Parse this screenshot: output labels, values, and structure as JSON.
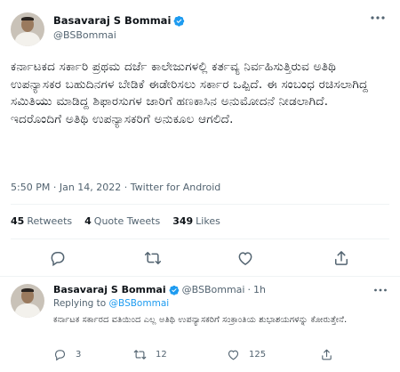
{
  "tweet": {
    "author_name": "Basavaraj S Bommai",
    "handle": "@BSBommai",
    "text": "ಕರ್ನಾಟಕದ ಸರ್ಕಾರಿ ಪ್ರಥಮ ದರ್ಜೆ ಕಾಲೇಜುಗಳಲ್ಲಿ ಕರ್ತವ್ಯ ನಿರ್ವಹಿಸುತ್ತಿರುವ ಅತಿಥಿ ಉಪನ್ಯಾಸಕರ ಬಹುದಿನಗಳ ಬೇಡಿಕೆ ಈಡೇರಿಸಲು ಸರ್ಕಾರ ಒಪ್ಪಿದೆ. ಈ ಸಂಬಂಧ ರಚಿಸಲಾಗಿದ್ದ ಸಮಿತಿಯು ಮಾಡಿದ್ದ ಶಿಫಾರಸುಗಳ ಜಾರಿಗೆ ಹಣಕಾಸಿನ ಅನುಮೋದನೆ ನೀಡಲಾಗಿದೆ. ಇದರೊಂದಿಗೆ  ಅತಿಥಿ ಉಪನ್ಯಾಸಕರಿಗೆ ಅನುಕೂಲ ಆಗಲಿದೆ.",
    "time": "5:50 PM",
    "date": "Jan 14, 2022",
    "source": "Twitter for Android",
    "separator": "·",
    "retweets_count": "45",
    "retweets_label": "Retweets",
    "quotes_count": "4",
    "quotes_label": "Quote Tweets",
    "likes_count": "349",
    "likes_label": "Likes"
  },
  "reply": {
    "author_name": "Basavaraj S Bommai",
    "handle": "@BSBommai",
    "age": "1h",
    "separator": "·",
    "replying_prefix": "Replying to",
    "replying_to": "@BSBommai",
    "text": "ಕರ್ನಾಟಕ ಸರ್ಕಾರದ ವತಿಯಿಂದ ಎಲ್ಲ ಅತಿಥಿ ಉಪನ್ಯಾಸಕರಿಗೆ ಸಂಕ್ರಾಂತಿಯ ಶುಭಾಶಯಗಳನ್ನು ಕೋರುತ್ತೇನೆ.",
    "replies_count": "3",
    "retweets_count": "12",
    "likes_count": "125"
  },
  "colors": {
    "accent": "#1d9bf0",
    "muted": "#536471",
    "text": "#0f1419"
  },
  "icons": [
    "verified-badge-icon",
    "more-icon",
    "reply-icon",
    "retweet-icon",
    "like-icon",
    "share-icon"
  ]
}
